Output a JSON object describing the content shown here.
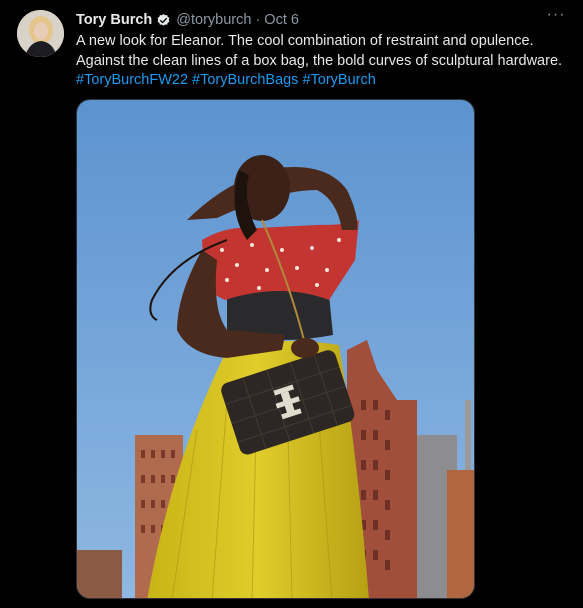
{
  "tweet": {
    "author_name": "Tory Burch",
    "handle": "@toryburch",
    "separator": "·",
    "date": "Oct 6",
    "more_label": "···",
    "text_line1": "A new look for Eleanor. The cool combination of restraint and opulence.",
    "text_line2": "Against the clean lines of a box bag, the bold curves of sculptural hardware.",
    "hashtags": [
      "#ToryBurchFW22",
      "#ToryBurchBags",
      "#ToryBurch"
    ],
    "verified_icon": "verified-badge-icon",
    "media_icon": "photo"
  },
  "colors": {
    "background": "#000000",
    "text": "#e7e9ea",
    "muted": "#8b98a5",
    "link": "#1d9bf0",
    "sky": "#6d9fd6",
    "skirt": "#d6c21c",
    "building": "#a4513e"
  }
}
